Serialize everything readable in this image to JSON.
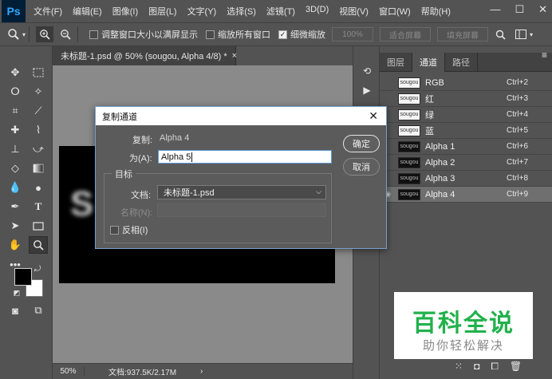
{
  "app": {
    "logo": "Ps",
    "menu": [
      "文件(F)",
      "编辑(E)",
      "图像(I)",
      "图层(L)",
      "文字(Y)",
      "选择(S)",
      "滤镜(T)",
      "3D(D)",
      "视图(V)",
      "窗口(W)",
      "帮助(H)"
    ],
    "window_controls": {
      "minimize": "—",
      "maximize": "☐",
      "close": "✕"
    }
  },
  "options_bar": {
    "resize_windows_label": "调整窗口大小以满屏显示",
    "resize_windows_checked": false,
    "zoom_all_label": "缩放所有窗口",
    "zoom_all_checked": false,
    "scrubby_zoom_label": "细微缩放",
    "scrubby_zoom_checked": true,
    "zoom_percent": "100%",
    "fit_screen": "适合屏幕",
    "fill_screen": "填充屏幕"
  },
  "document": {
    "tab_title": "未标题-1.psd @ 50% (sougou, Alpha 4/8) *",
    "tab_close": "×",
    "canvas_text": "S",
    "zoom": "50%",
    "doc_info": "文档:937.5K/2.17M",
    "status_arrow": "›"
  },
  "panels": {
    "tabs": [
      "图层",
      "通道",
      "路径"
    ],
    "active_tab": 1,
    "menu_icon": "≡",
    "channels": [
      {
        "name": "RGB",
        "shortcut": "Ctrl+2",
        "thumb": "sougou",
        "thumb_style": "light",
        "selected": false
      },
      {
        "name": "红",
        "shortcut": "Ctrl+3",
        "thumb": "sougou",
        "thumb_style": "light",
        "selected": false
      },
      {
        "name": "绿",
        "shortcut": "Ctrl+4",
        "thumb": "sougou",
        "thumb_style": "light",
        "selected": false
      },
      {
        "name": "蓝",
        "shortcut": "Ctrl+5",
        "thumb": "sougou",
        "thumb_style": "light",
        "selected": false
      },
      {
        "name": "Alpha 1",
        "shortcut": "Ctrl+6",
        "thumb": "sougou",
        "thumb_style": "dark",
        "selected": false
      },
      {
        "name": "Alpha 2",
        "shortcut": "Ctrl+7",
        "thumb": "sougou",
        "thumb_style": "dark",
        "selected": false
      },
      {
        "name": "Alpha 3",
        "shortcut": "Ctrl+8",
        "thumb": "sougou",
        "thumb_style": "dark",
        "selected": false
      },
      {
        "name": "Alpha 4",
        "shortcut": "Ctrl+9",
        "thumb": "sougou",
        "thumb_style": "dark",
        "selected": true
      }
    ]
  },
  "watermark": {
    "title": "百科全说",
    "subtitle": "助你轻松解决"
  },
  "dialog": {
    "title": "复制通道",
    "close": "✕",
    "duplicate_label": "复制:",
    "duplicate_value": "Alpha 4",
    "as_label": "为(A):",
    "as_value": "Alpha 5",
    "destination_label": "目标",
    "document_label": "文档:",
    "document_value": "未标题-1.psd",
    "name_label": "名称(N):",
    "invert_label": "反相(I)",
    "invert_checked": false,
    "ok_label": "确定",
    "cancel_label": "取消"
  }
}
